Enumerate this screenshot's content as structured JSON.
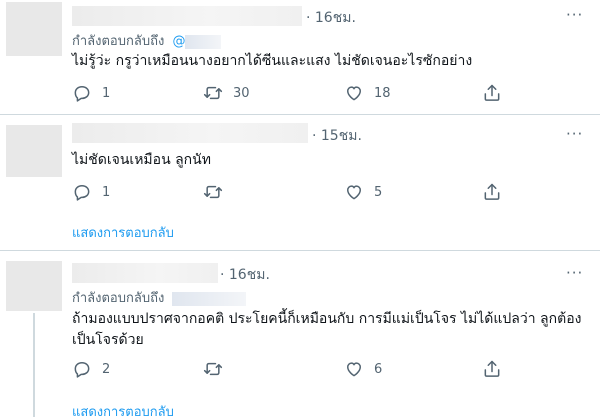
{
  "replies": [
    {
      "time": "· 16ชม.",
      "reply_prefix": "กำลังตอบกลับถึง",
      "reply_handle": "@",
      "text": "ไม่รู้ว่ะ กรูว่าเหมือนนางอยากได้ซีนและแสง ไม่ชัดเจนอะไรซักอย่าง",
      "replies_count": "1",
      "retweets_count": "30",
      "likes_count": "18"
    },
    {
      "time": "· 15ชม.",
      "text": "ไม่ชัดเจนเหมือน ลูกนัท",
      "replies_count": "1",
      "retweets_count": "",
      "likes_count": "5",
      "show_replies": "แสดงการตอบกลับ"
    },
    {
      "time": "· 16ชม.",
      "reply_prefix": "กำลังตอบกลับถึง",
      "text_line1": "ถ้ามองแบบปราศจากอคติ ประโยคนี้ก็เหมือนกับ การมีแม่เป็นโจร ไม่ได้แปลว่า ลูกต้อง",
      "text_line2": "เป็นโจรด้วย",
      "replies_count": "2",
      "retweets_count": "",
      "likes_count": "6",
      "show_replies": "แสดงการตอบกลับ"
    }
  ],
  "more_label": "···",
  "icons": {
    "reply": "reply-icon",
    "retweet": "retweet-icon",
    "like": "heart-icon",
    "share": "share-icon",
    "more": "more-icon"
  },
  "colors": {
    "link": "#1d9bf0",
    "muted": "#536471",
    "text": "#0f1419",
    "divider": "#cfd9de"
  }
}
